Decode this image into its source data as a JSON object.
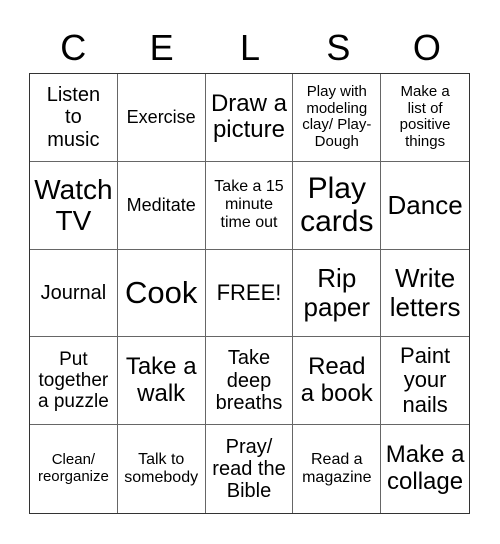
{
  "card": {
    "header_letters": [
      "C",
      "E",
      "L",
      "S",
      "O"
    ],
    "cells": [
      {
        "text": "Listen\nto\nmusic",
        "size": 20
      },
      {
        "text": "Exercise",
        "size": 18
      },
      {
        "text": "Draw a\npicture",
        "size": 24
      },
      {
        "text": "Play with\nmodeling\nclay/ Play-\nDough",
        "size": 15
      },
      {
        "text": "Make a\nlist of\npositive\nthings",
        "size": 15
      },
      {
        "text": "Watch\nTV",
        "size": 28
      },
      {
        "text": "Meditate",
        "size": 18
      },
      {
        "text": "Take a 15\nminute\ntime out",
        "size": 16
      },
      {
        "text": "Play\ncards",
        "size": 30
      },
      {
        "text": "Dance",
        "size": 26
      },
      {
        "text": "Journal",
        "size": 20
      },
      {
        "text": "Cook",
        "size": 31
      },
      {
        "text": "FREE!",
        "size": 22
      },
      {
        "text": "Rip\npaper",
        "size": 26
      },
      {
        "text": "Write\nletters",
        "size": 26
      },
      {
        "text": "Put\ntogether\na puzzle",
        "size": 19
      },
      {
        "text": "Take a\nwalk",
        "size": 24
      },
      {
        "text": "Take\ndeep\nbreaths",
        "size": 20
      },
      {
        "text": "Read\na book",
        "size": 24
      },
      {
        "text": "Paint\nyour\nnails",
        "size": 22
      },
      {
        "text": "Clean/\nreorganize",
        "size": 15
      },
      {
        "text": "Talk to\nsomebody",
        "size": 16
      },
      {
        "text": "Pray/\nread the\nBible",
        "size": 20
      },
      {
        "text": "Read a\nmagazine",
        "size": 16
      },
      {
        "text": "Make a\ncollage",
        "size": 24
      }
    ]
  }
}
